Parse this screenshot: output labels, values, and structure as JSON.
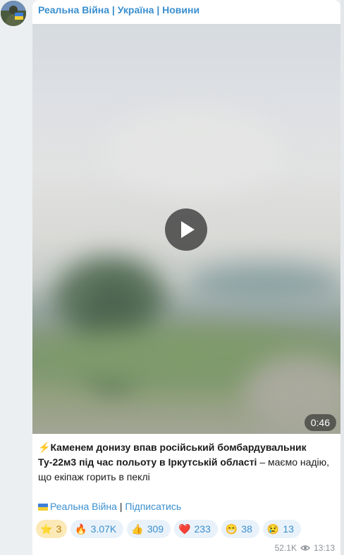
{
  "channel": {
    "name": "Реальна Війна | Україна | Новини"
  },
  "video": {
    "duration": "0:46"
  },
  "post": {
    "bolt": "⚡",
    "headline_line1": "Каменем донизу впав російський бомбардувальник",
    "headline_line2": "Ту-22м3 під час польоту в Іркутській області",
    "body_tail": " – маємо надію,",
    "body_line3": "що екіпаж горить в пеклі",
    "footer_link": "Реальна Війна",
    "footer_sep": " | ",
    "subscribe": "Підписатись"
  },
  "reactions": [
    {
      "emoji": "⭐",
      "count": "3"
    },
    {
      "emoji": "🔥",
      "count": "3.07K"
    },
    {
      "emoji": "👍",
      "count": "309"
    },
    {
      "emoji": "❤️",
      "count": "233"
    },
    {
      "emoji": "😁",
      "count": "38"
    },
    {
      "emoji": "😢",
      "count": "13"
    }
  ],
  "meta": {
    "views": "52.1K",
    "time": "13:13"
  },
  "colors": {
    "accent": "#3a8fcf",
    "bubble": "#ffffff",
    "background": "#eceff2"
  }
}
